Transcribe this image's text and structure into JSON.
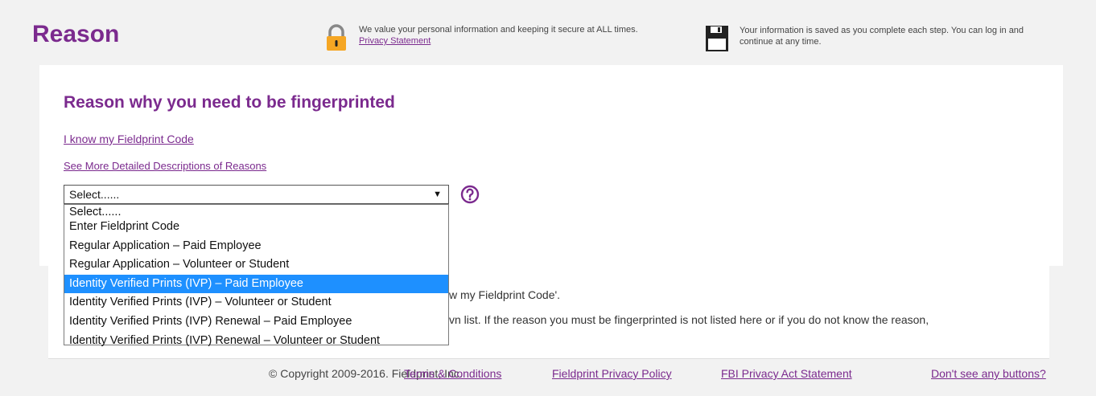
{
  "header": {
    "title": "Reason",
    "secure_notice": "We value your personal information and keeping it secure at ALL times.",
    "privacy_link": "Privacy Statement",
    "saved_notice": "Your information is saved as you complete each step. You can log in and continue at any time."
  },
  "main": {
    "section_title": "Reason why you need to be fingerprinted",
    "know_code_link": "I know my Fieldprint Code",
    "descriptions_link": "See More Detailed Descriptions of Reasons",
    "select": {
      "value": "Select......",
      "arrow": "▼",
      "options": [
        "Select......",
        "Enter Fieldprint Code",
        "Regular Application – Paid Employee",
        "Regular Application – Volunteer or Student",
        "Identity Verified Prints (IVP) – Paid Employee",
        "Identity Verified Prints (IVP) – Volunteer or Student",
        "Identity Verified Prints (IVP) Renewal – Paid Employee",
        "Identity Verified Prints (IVP) Renewal – Volunteer or Student"
      ],
      "highlighted_index": 4
    },
    "help_icon": "question-circle-icon",
    "lower_text_1": "w my Fieldprint Code'.",
    "lower_text_2": "vn list. If the reason you must be fingerprinted is not listed here or if you do not know the reason,"
  },
  "footer": {
    "copyright": "© Copyright 2009-2016. Fieldprint, Inc.",
    "terms": "Terms & Conditions",
    "privacy_policy": "Fieldprint Privacy Policy",
    "fbi": "FBI Privacy Act Statement",
    "no_buttons": "Don't see any buttons?"
  },
  "colors": {
    "brand_purple": "#7b2a8e",
    "highlight_blue": "#1e90ff",
    "lock_orange": "#f5a623"
  }
}
